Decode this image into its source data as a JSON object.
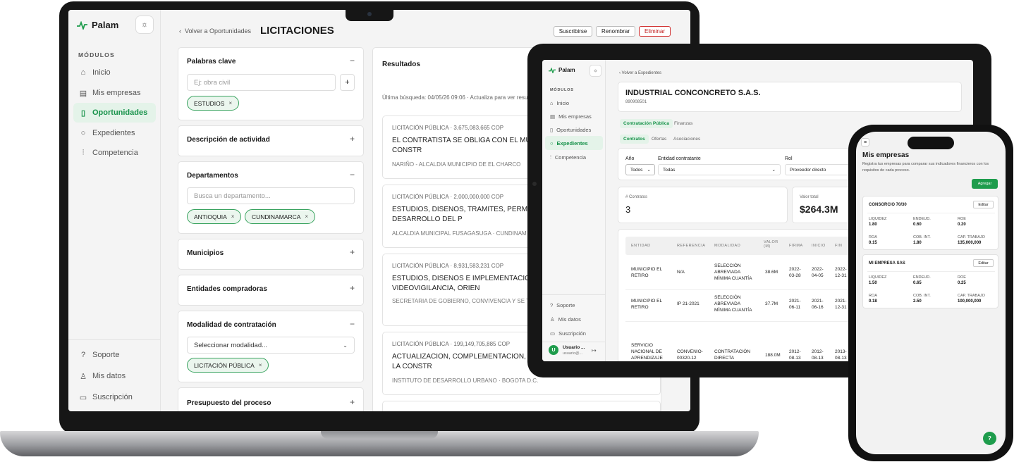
{
  "laptop": {
    "logo": "Palam",
    "section_label": "MÓDULOS",
    "nav": [
      {
        "label": "Inicio",
        "icon": "home-icon"
      },
      {
        "label": "Mis empresas",
        "icon": "calendar-icon"
      },
      {
        "label": "Oportunidades",
        "icon": "document-icon"
      },
      {
        "label": "Expedientes",
        "icon": "search-icon"
      },
      {
        "label": "Competencia",
        "icon": "bar-chart-icon"
      }
    ],
    "bottom_nav": [
      {
        "label": "Soporte",
        "icon": "help-icon"
      },
      {
        "label": "Mis datos",
        "icon": "user-icon"
      },
      {
        "label": "Suscripción",
        "icon": "card-icon"
      }
    ],
    "back_label": "Volver a Oportunidades",
    "page_title": "LICITACIONES",
    "actions": {
      "subscribe": "Suscribirse",
      "rename": "Renombrar",
      "delete": "Eliminar"
    },
    "filters": {
      "keywords": {
        "title": "Palabras clave",
        "placeholder": "Ej: obra civil",
        "add": "+",
        "tags": [
          "ESTUDIOS"
        ]
      },
      "activity": {
        "title": "Descripción de actividad"
      },
      "departments": {
        "title": "Departamentos",
        "placeholder": "Busca un departamento...",
        "tags": [
          "ANTIOQUIA",
          "CUNDINAMARCA"
        ]
      },
      "municipalities": {
        "title": "Municipios"
      },
      "entities": {
        "title": "Entidades compradoras"
      },
      "modality": {
        "title": "Modalidad de contratación",
        "select": "Seleccionar modalidad...",
        "tags": [
          "LICITACIÓN PÚBLICA"
        ]
      },
      "budget": {
        "title": "Presupuesto del proceso"
      }
    },
    "results": {
      "title": "Resultados",
      "last_search": "Última búsqueda: 04/05/26 09:06 · Actualiza para ver resulta",
      "items": [
        {
          "meta": "LICITACIÓN PÚBLICA · 3,675,083,665 COP",
          "title": "EL CONTRATISTA SE OBLIGA CON EL MUNI REALIZAR ESTUDIOS; DISEÑOS Y CONSTR",
          "sub": "NARIÑO - ALCALDIA MUNICIPIO DE EL CHARCO"
        },
        {
          "meta": "LICITACIÓN PÚBLICA · 2,000,000,000 COP",
          "title": "ESTUDIOS, DISENOS, TRAMITES, PERMISO REQUERIDAS PARA EL DESARROLLO DEL P",
          "sub": "ALCALDIA MUNICIPAL FUSAGASUGA · CUNDINAM"
        },
        {
          "meta": "LICITACIÓN PÚBLICA · 8,931,583,231 COP",
          "title": "ESTUDIOS, DISENOS E IMPLEMENTACION DEL SISTEMA DE VIDEOVIGILANCIA, ORIEN",
          "sub": "SECRETARIA DE GOBIERNO, CONVIVENCIA Y SE TULUA · VALLE DEL CAUCA"
        },
        {
          "meta": "LICITACIÓN PÚBLICA · 199,149,705,885 COP",
          "title": "ACTUALIZACION, COMPLEMENTACION, AJU DE LOS ESTUDIOS Y DISENOS Y LA CONSTR",
          "sub": "INSTITUTO DE DESARROLLO URBANO · BOGOTA D.C."
        }
      ]
    }
  },
  "tablet": {
    "logo": "Palam",
    "section_label": "MÓDULOS",
    "nav": [
      {
        "label": "Inicio",
        "icon": "home-icon"
      },
      {
        "label": "Mis empresas",
        "icon": "calendar-icon"
      },
      {
        "label": "Oportunidades",
        "icon": "document-icon"
      },
      {
        "label": "Expedientes",
        "icon": "search-icon"
      },
      {
        "label": "Competencia",
        "icon": "bar-chart-icon"
      }
    ],
    "bottom_nav": [
      {
        "label": "Soporte",
        "icon": "help-icon"
      },
      {
        "label": "Mis datos",
        "icon": "user-icon"
      },
      {
        "label": "Suscripción",
        "icon": "card-icon"
      }
    ],
    "user": {
      "initial": "U",
      "name": "Usuario ...",
      "email": "usuario@..."
    },
    "back_label": "Volver a Expedientes",
    "company_name": "INDUSTRIAL CONCONCRETO S.A.S.",
    "company_id": "890908501",
    "tabs": [
      "Contratación Pública",
      "Finanzas"
    ],
    "subtabs": [
      "Contratos",
      "Ofertas",
      "Asociaciones"
    ],
    "filters": {
      "year_label": "Año",
      "year_value": "Todos",
      "entity_label": "Entidad contratante",
      "entity_value": "Todas",
      "role_label": "Rol",
      "role_value": "Proveedor directo"
    },
    "stats": {
      "contracts_label": "# Contratos",
      "contracts_value": "3",
      "total_label": "Valor total",
      "total_value": "$264.3M"
    },
    "table": {
      "headers": [
        "ENTIDAD",
        "REFERENCIA",
        "MODALIDAD",
        "VALOR (M)",
        "FIRMA",
        "INICIO",
        "FIN"
      ],
      "rows": [
        [
          "MUNICIPIO EL RETIRO",
          "N/A",
          "SELECCIÓN ABREVIADA MÍNIMA CUANTÍA",
          "38.6M",
          "2022-03-28",
          "2022-04-05",
          "2022-12-31"
        ],
        [
          "MUNICIPIO EL RETIRO",
          "IP 21-2021",
          "SELECCIÓN ABREVIADA MÍNIMA CUANTÍA",
          "37.7M",
          "2021-06-11",
          "2021-06-16",
          "2021-12-31"
        ],
        [
          "SERVICIO NACIONAL DE APRENDIZAJE",
          "CONVENIO-00320-12",
          "CONTRATACIÓN DIRECTA",
          "188.0M",
          "2012-08-13",
          "2012-08-13",
          "2013-08-13"
        ]
      ]
    }
  },
  "phone": {
    "title": "Mis empresas",
    "description": "Registra tus empresas para comparar sus indicadores financieros con los requisitos de cada proceso.",
    "add_button": "Agregar",
    "edit_label": "Editar",
    "companies": [
      {
        "name": "CONSORCIO 70/30",
        "metrics": [
          [
            "LIQUIDEZ",
            "1.80"
          ],
          [
            "ENDEUD.",
            "0.60"
          ],
          [
            "ROE",
            "0.20"
          ],
          [
            "ROA",
            "0.15"
          ],
          [
            "COB. INT.",
            "1.80"
          ],
          [
            "CAP. TRABAJO",
            "135,000,000"
          ]
        ]
      },
      {
        "name": "MI EMPRESA SAS",
        "metrics": [
          [
            "LIQUIDEZ",
            "1.50"
          ],
          [
            "ENDEUD.",
            "0.65"
          ],
          [
            "ROE",
            "0.25"
          ],
          [
            "ROA",
            "0.18"
          ],
          [
            "COB. INT.",
            "2.50"
          ],
          [
            "CAP. TRABAJO",
            "100,000,000"
          ]
        ]
      }
    ],
    "help": "?"
  },
  "colors": {
    "accent": "#1e9c4c",
    "accent_bg": "#e4f3e9",
    "danger": "#c02020"
  }
}
